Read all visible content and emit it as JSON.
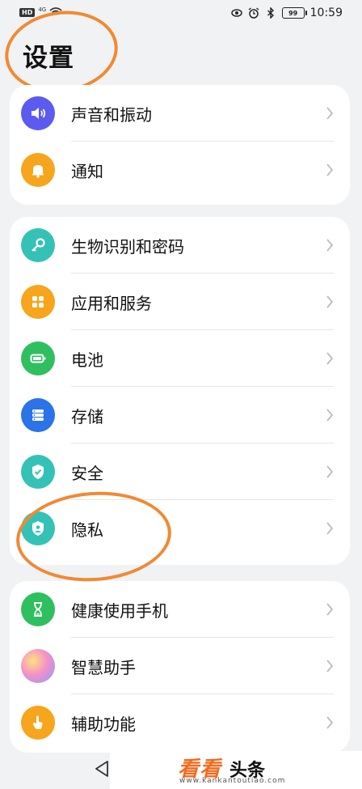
{
  "status_bar": {
    "left_badge": "HD",
    "signal_text": "4G",
    "time": "10:59",
    "battery_text": "99"
  },
  "page": {
    "title": "设置"
  },
  "groups": [
    {
      "items": [
        {
          "label": "声音和振动",
          "icon": "speaker-icon",
          "color": "#5b5bf0"
        },
        {
          "label": "通知",
          "icon": "bell-icon",
          "color": "#f6a51c"
        }
      ]
    },
    {
      "items": [
        {
          "label": "生物识别和密码",
          "icon": "key-icon",
          "color": "#35c2b6"
        },
        {
          "label": "应用和服务",
          "icon": "apps-icon",
          "color": "#f6a51c"
        },
        {
          "label": "电池",
          "icon": "battery-icon",
          "color": "#2fbf5f"
        },
        {
          "label": "存储",
          "icon": "storage-icon",
          "color": "#2a73e8"
        },
        {
          "label": "安全",
          "icon": "shield-check-icon",
          "color": "#35c2b6"
        },
        {
          "label": "隐私",
          "icon": "privacy-shield-icon",
          "color": "#35c2b6"
        }
      ]
    },
    {
      "items": [
        {
          "label": "健康使用手机",
          "icon": "hourglass-icon",
          "color": "#2fbf5f"
        },
        {
          "label": "智慧助手",
          "icon": "assistant-orb-icon",
          "color": "#e879c0"
        },
        {
          "label": "辅助功能",
          "icon": "hand-icon",
          "color": "#f6a51c"
        }
      ]
    }
  ],
  "watermark": {
    "brand": "看看",
    "brand_suffix": "头条",
    "url": "www.kankantoutiao.com"
  }
}
